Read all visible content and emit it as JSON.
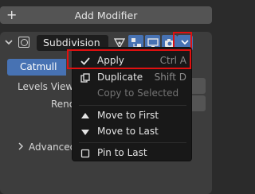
{
  "add_modifier": {
    "label": "Add Modifier"
  },
  "modifier": {
    "name": "Subdivision",
    "tab_active": "Catmull",
    "rows": {
      "levels_viewport": "Levels Viewp",
      "render": "Rende",
      "advanced": "Advanced"
    }
  },
  "menu": {
    "items": [
      {
        "label": "Apply",
        "shortcut": "Ctrl A",
        "icon": "checkmark-icon"
      },
      {
        "label": "Duplicate",
        "shortcut": "Shift D",
        "icon": "duplicate-icon"
      },
      {
        "label": "Copy to Selected",
        "shortcut": "",
        "icon": ""
      },
      {
        "label": "Move to First",
        "shortcut": "",
        "icon": "triangle-up-icon"
      },
      {
        "label": "Move to Last",
        "shortcut": "",
        "icon": "triangle-down-icon"
      },
      {
        "label": "Pin to Last",
        "shortcut": "",
        "icon": "checkbox-icon"
      }
    ]
  },
  "colors": {
    "accent": "#4772b3",
    "highlight_box": "#e01010",
    "menu_bg": "#181818",
    "panel_bg": "#3d3d3d"
  }
}
